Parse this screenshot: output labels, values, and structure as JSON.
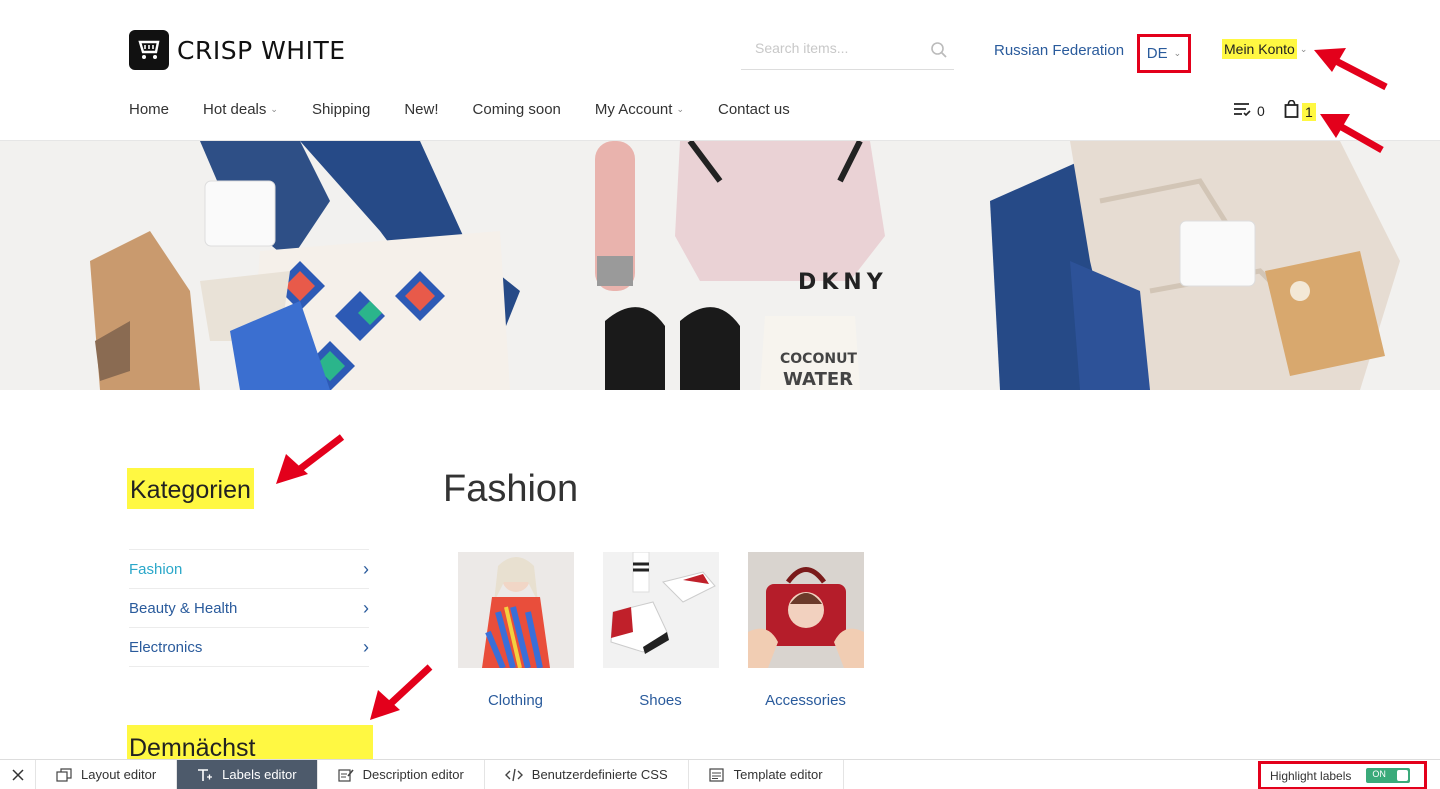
{
  "header": {
    "logo_text": "CRISP WHITE",
    "search_placeholder": "Search items...",
    "country": "Russian Federation",
    "language": "DE",
    "account": "Mein Konto",
    "compare_count": "0",
    "cart_count": "1"
  },
  "nav": {
    "items": [
      "Home",
      "Hot deals",
      "Shipping",
      "New!",
      "Coming soon",
      "My Account",
      "Contact us"
    ]
  },
  "sidebar": {
    "categories_title": "Kategorien",
    "categories": [
      "Fashion",
      "Beauty & Health",
      "Electronics"
    ],
    "coming_soon_title": "Demnächst"
  },
  "main": {
    "title": "Fashion",
    "subcategories": [
      "Clothing",
      "Shoes",
      "Accessories"
    ]
  },
  "editor_bar": {
    "tabs": [
      "Layout editor",
      "Labels editor",
      "Description editor",
      "Benutzerdefinierte CSS",
      "Template editor"
    ],
    "highlight_label": "Highlight labels",
    "toggle_state": "ON"
  },
  "colors": {
    "link": "#2a5b9c",
    "active_link": "#2aa7c9",
    "highlight": "#fff842",
    "annotation": "#e3001b",
    "active_tab": "#4d5a6b",
    "toggle": "#3aaa7a"
  }
}
